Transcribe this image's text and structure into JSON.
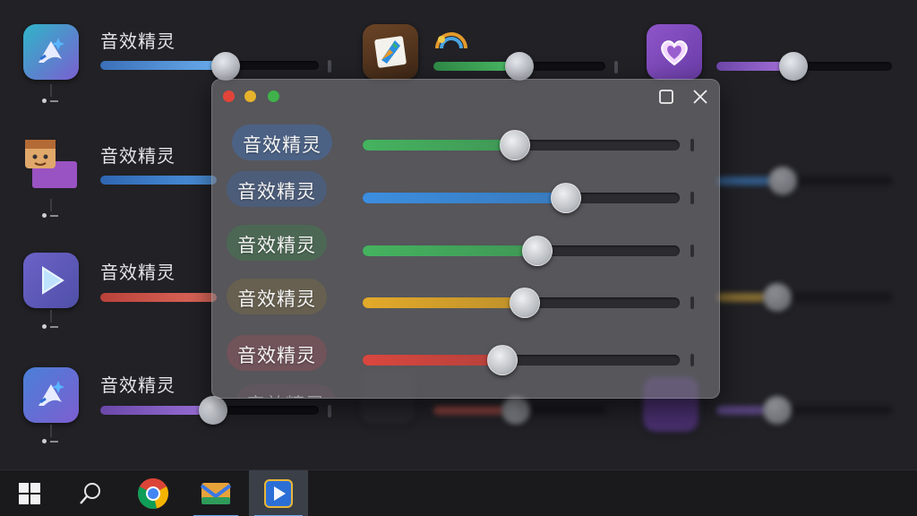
{
  "app_label": "音效精灵",
  "background_left": [
    {
      "label": "音效精灵",
      "icon": "sparkle-app-icon",
      "fill_color": "#4a90d6",
      "level": 0.47
    },
    {
      "label": "音效精灵",
      "icon": "character-app-icon",
      "fill_color": "#3f86d2",
      "level": 0.47
    },
    {
      "label": "音效精灵",
      "icon": "play-app-icon",
      "fill_color": "#d2564d",
      "level": 0.47
    },
    {
      "label": "音效精灵",
      "icon": "sparkle-app-icon",
      "fill_color": "#7e5bbd",
      "level": 0.5
    }
  ],
  "panel": {
    "rows": [
      {
        "label": "音效精灵",
        "color": "#45b35f",
        "pill_bg": "rgba(70,110,170,0.55)",
        "level": 0.48
      },
      {
        "label": "音效精灵",
        "color": "#3c8ee0",
        "pill_bg": "rgba(70,100,150,0.55)",
        "level": 0.64
      },
      {
        "label": "音效精灵",
        "color": "#45b35f",
        "pill_bg": "rgba(70,120,80,0.55)",
        "level": 0.55
      },
      {
        "label": "音效精灵",
        "color": "#e3aa2a",
        "pill_bg": "rgba(120,105,70,0.5)",
        "level": 0.51
      },
      {
        "label": "音效精灵",
        "color": "#d9473f",
        "pill_bg": "rgba(140,80,90,0.5)",
        "level": 0.44
      }
    ],
    "partial_label": "音效精灵"
  },
  "taskbar": {
    "items": [
      "windows-start",
      "search",
      "chrome",
      "mail",
      "media-player"
    ]
  }
}
